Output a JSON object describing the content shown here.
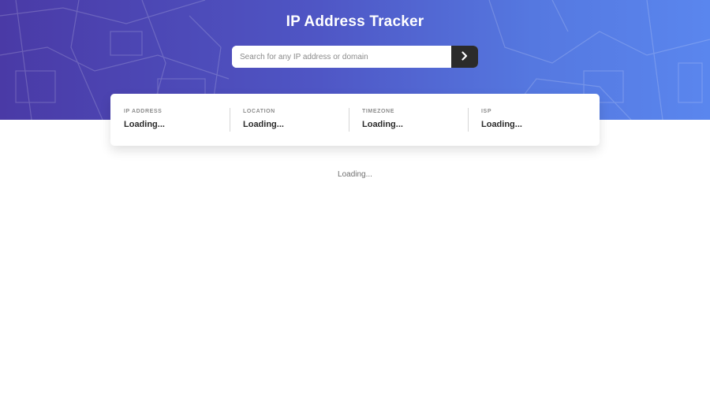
{
  "header": {
    "title": "IP Address Tracker",
    "gradient_start": "#4a3aa6",
    "gradient_end": "#5a86ee"
  },
  "search": {
    "placeholder": "Search for any IP address or domain",
    "value": "",
    "button_icon": "chevron-right-icon",
    "button_color": "#2b2b2b"
  },
  "info": {
    "ip": {
      "label": "IP ADDRESS",
      "value": "Loading..."
    },
    "location": {
      "label": "LOCATION",
      "value": "Loading..."
    },
    "timezone": {
      "label": "TIMEZONE",
      "value": "Loading..."
    },
    "isp": {
      "label": "ISP",
      "value": "Loading..."
    }
  },
  "map": {
    "status": "Loading..."
  }
}
